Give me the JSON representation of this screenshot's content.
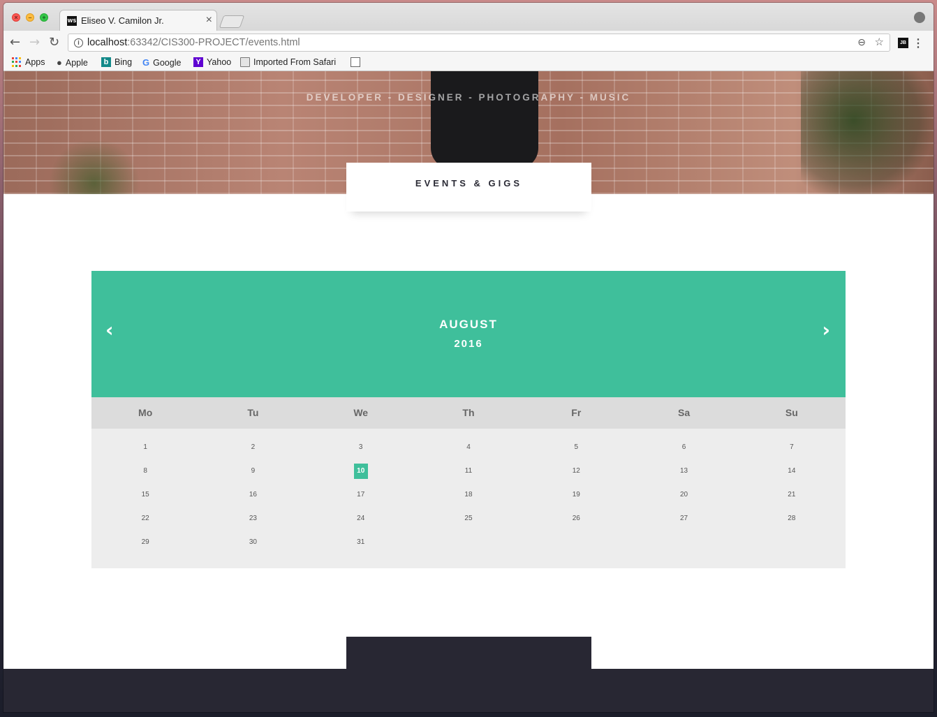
{
  "browser": {
    "tab_title": "Eliseo V. Camilon Jr.",
    "tab_favicon": "WS",
    "url_host": "localhost",
    "url_path": ":63342/CIS300-PROJECT/events.html",
    "bookmarks": [
      {
        "label": "Apps",
        "icon": "apps-grid-icon"
      },
      {
        "label": "Apple",
        "icon": "apple-icon"
      },
      {
        "label": "Bing",
        "icon": "bing-icon"
      },
      {
        "label": "Google",
        "icon": "google-icon"
      },
      {
        "label": "Yahoo",
        "icon": "yahoo-icon"
      },
      {
        "label": "Imported From Safari",
        "icon": "folder-icon"
      }
    ],
    "extension_label": "JB"
  },
  "hero": {
    "tagline": "DEVELOPER - DESIGNER - PHOTOGRAPHY - MUSIC"
  },
  "section": {
    "title": "EVENTS & GIGS"
  },
  "calendar": {
    "month": "AUGUST",
    "year": "2016",
    "prev": "‹",
    "next": "›",
    "accent_color": "#3fbf9b",
    "weekdays": [
      "Mo",
      "Tu",
      "We",
      "Th",
      "Fr",
      "Sa",
      "Su"
    ],
    "days": [
      "1",
      "2",
      "3",
      "4",
      "5",
      "6",
      "7",
      "8",
      "9",
      "10",
      "11",
      "12",
      "13",
      "14",
      "15",
      "16",
      "17",
      "18",
      "19",
      "20",
      "21",
      "22",
      "23",
      "24",
      "25",
      "26",
      "27",
      "28",
      "29",
      "30",
      "31"
    ],
    "today": "10"
  },
  "colors": {
    "footer": "#282733",
    "weekday_bar": "#dcdcdc",
    "days_bg": "#ededed"
  }
}
